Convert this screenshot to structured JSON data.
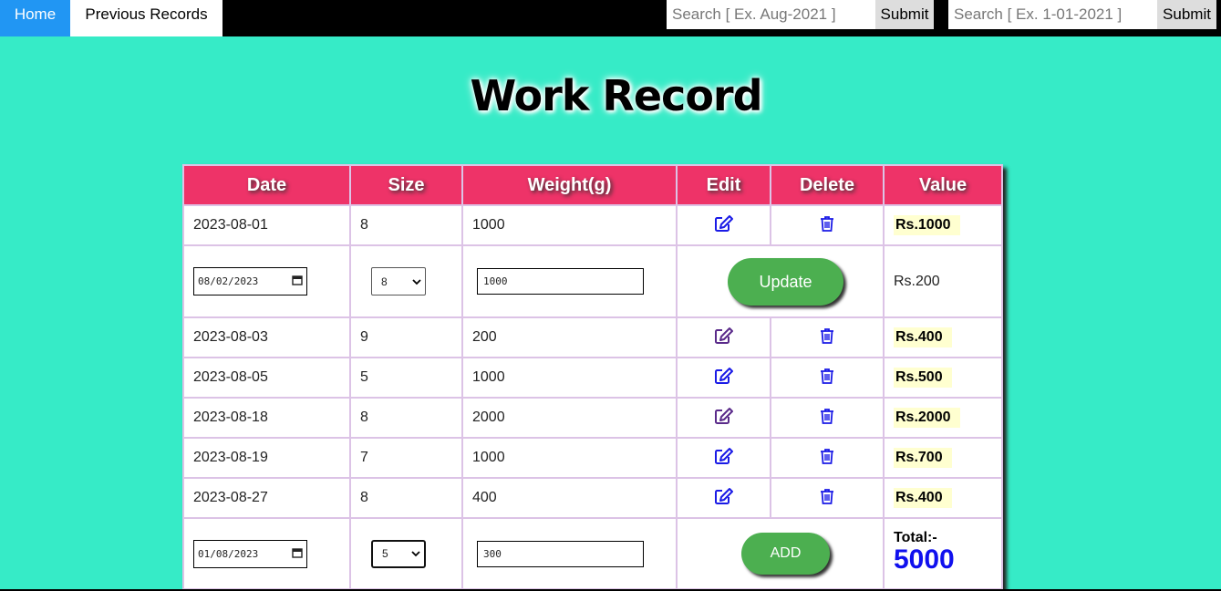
{
  "nav": {
    "home": "Home",
    "previous": "Previous Records"
  },
  "search": {
    "month_placeholder": "Search [ Ex. Aug-2021 ]",
    "date_placeholder": "Search [ Ex. 1-01-2021 ]",
    "submit": "Submit"
  },
  "title": "Work Record",
  "table": {
    "headers": [
      "Date",
      "Size",
      "Weight(g)",
      "Edit",
      "Delete",
      "Value"
    ],
    "rows": [
      {
        "date": "2023-08-01",
        "size": "8",
        "weight": "1000",
        "value": "Rs.1000"
      },
      {
        "date": "2023-08-03",
        "size": "9",
        "weight": "200",
        "value": "Rs.400"
      },
      {
        "date": "2023-08-05",
        "size": "5",
        "weight": "1000",
        "value": "Rs.500"
      },
      {
        "date": "2023-08-18",
        "size": "8",
        "weight": "2000",
        "value": "Rs.2000"
      },
      {
        "date": "2023-08-19",
        "size": "7",
        "weight": "1000",
        "value": "Rs.700"
      },
      {
        "date": "2023-08-27",
        "size": "8",
        "weight": "400",
        "value": "Rs.400"
      }
    ]
  },
  "edit_row": {
    "date": "08/02/2023",
    "size": "8",
    "weight": "1000",
    "button": "Update",
    "value": "Rs.200"
  },
  "add_row": {
    "date": "01/08/2023",
    "size": "5",
    "weight": "300",
    "button": "ADD",
    "total_label": "Total:-",
    "total_value": "5000"
  },
  "colors": {
    "background": "#36ebc7",
    "header": "#ee3368",
    "home_tab": "#2196f3",
    "button": "#4caf50",
    "total": "#1010ee",
    "icon": "#1a1ae6"
  },
  "icons": {
    "edit": "edit-icon",
    "delete": "trash-icon"
  }
}
